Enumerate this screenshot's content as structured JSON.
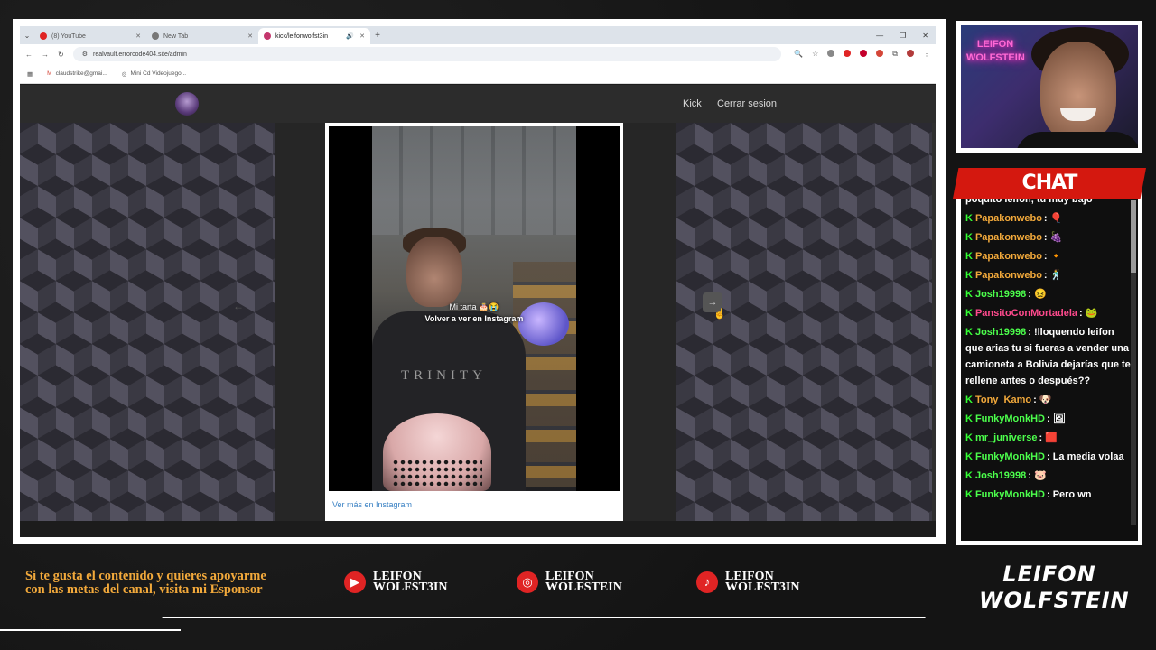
{
  "browser": {
    "tabs": [
      {
        "title": "(8) YouTube",
        "fav_color": "#e02424"
      },
      {
        "title": "New Tab",
        "fav_color": "#666666"
      },
      {
        "title": "kick/leifonwolfst3in",
        "fav_color": "#c4366d"
      }
    ],
    "url": "realvault.errorcode404.site/admin",
    "bookmarks": [
      "claudstrike@gmai...",
      "Mini Cd Videojuego..."
    ]
  },
  "site": {
    "nav_kick": "Kick",
    "nav_logout": "Cerrar sesion",
    "video_caption": "Mi tarta 🎂😭",
    "video_overlay": "Volver a ver en Instagram",
    "shirt_text": "TRINITY",
    "ig_link": "Ver más en Instagram"
  },
  "webcam": {
    "neon_line1": "LEIFON",
    "neon_line2": "WOLFSTEIN"
  },
  "chat": {
    "title": "CHAT",
    "messages": [
      {
        "user": "",
        "text": "poquito leifon, tu muy bajo",
        "color": "#ffffff"
      },
      {
        "user": "Papakonwebo",
        "text": "🎈",
        "color": "#f2a93b"
      },
      {
        "user": "Papakonwebo",
        "text": "🍇",
        "color": "#f2a93b"
      },
      {
        "user": "Papakonwebo",
        "text": "🔸",
        "color": "#f2a93b"
      },
      {
        "user": "Papakonwebo",
        "text": "🕺",
        "color": "#f2a93b"
      },
      {
        "user": "Josh19998",
        "text": "😖",
        "color": "#4cff4c"
      },
      {
        "user": "PansitoConMortadela",
        "text": "🐸",
        "color": "#ff4a8d"
      },
      {
        "user": "Josh19998",
        "text": "!lloquendo leifon que arias tu si fueras a vender una camioneta a Bolivia dejarías que te rellene antes o después??",
        "color": "#4cff4c"
      },
      {
        "user": "Tony_Kamo",
        "text": "🐶",
        "color": "#f2a93b"
      },
      {
        "user": "FunkyMonkHD",
        "text": "🖼",
        "color": "#4cff4c"
      },
      {
        "user": "mr_juniverse",
        "text": "🟥",
        "color": "#4cff4c"
      },
      {
        "user": "FunkyMonkHD",
        "text": "La media volaa",
        "color": "#4cff4c"
      },
      {
        "user": "Josh19998",
        "text": "🐷",
        "color": "#4cff4c"
      },
      {
        "user": "FunkyMonkHD",
        "text": "Pero wn",
        "color": "#4cff4c"
      }
    ]
  },
  "footer": {
    "sponsor_text": "Si te gusta el contenido y quieres apoyarme con las metas del canal, visita mi Esponsor",
    "socials": [
      {
        "icon": "youtube-icon",
        "line1": "LEIFON",
        "line2": "WOLFST3IN"
      },
      {
        "icon": "instagram-icon",
        "line1": "LEIFON",
        "line2": "WOLFSTEIN"
      },
      {
        "icon": "tiktok-icon",
        "line1": "LEIFON",
        "line2": "WOLFST3IN"
      }
    ],
    "brand_line1": "LEIFON",
    "brand_line2": "WOLFSTEIN"
  },
  "colors": {
    "accent_red": "#d4180f",
    "sponsor_orange": "#f2a93b",
    "chat_green": "#4cff4c"
  }
}
